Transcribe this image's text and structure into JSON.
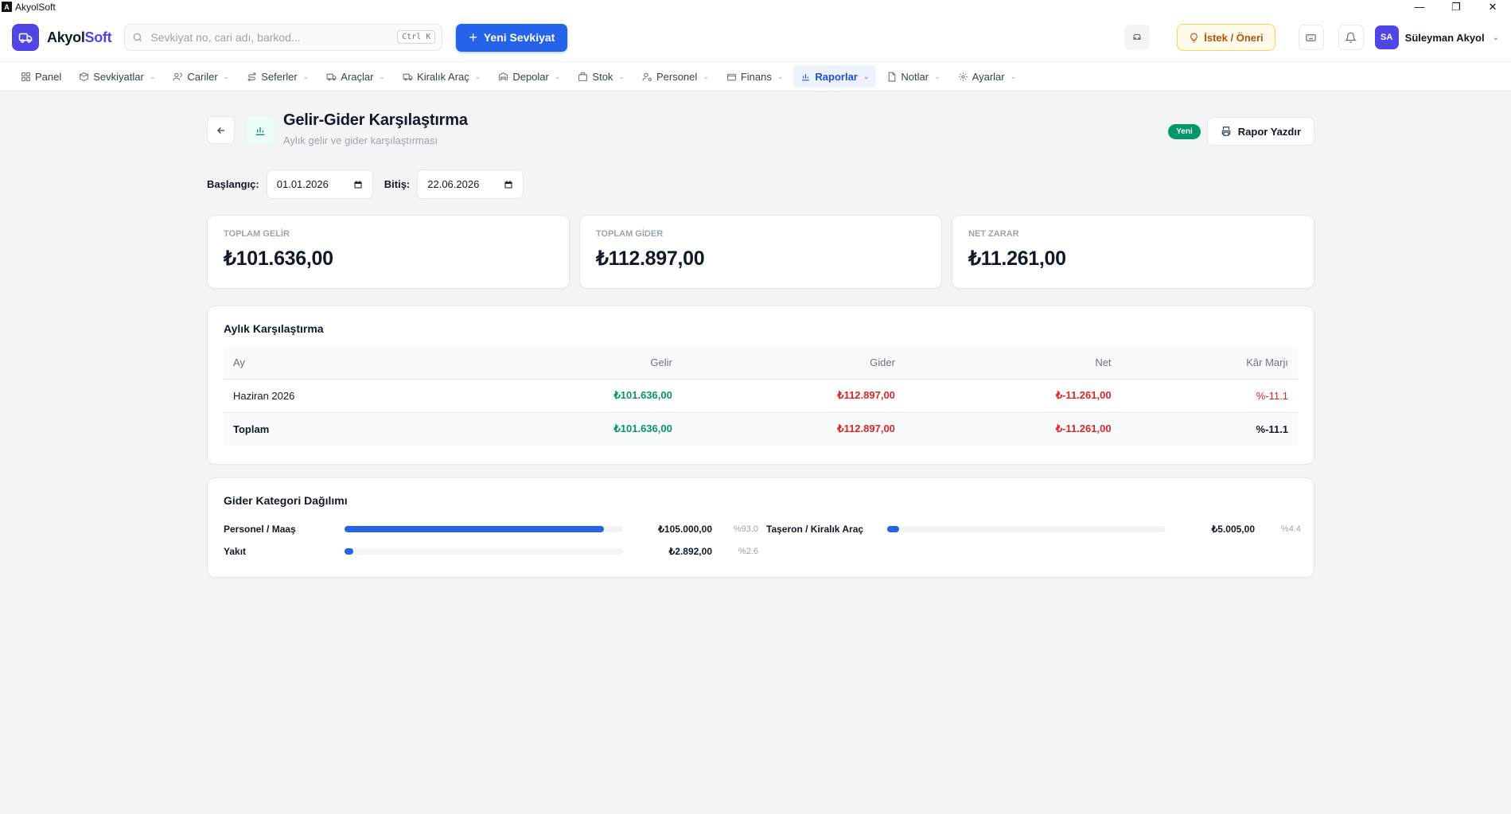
{
  "window": {
    "title": "AkyolSoft"
  },
  "topbar": {
    "brand_a": "Akyol",
    "brand_b": "Soft",
    "search_placeholder": "Sevkiyat no, cari adı, barkod...",
    "search_shortcut": "Ctrl K",
    "new_shipment": "Yeni Sevkiyat",
    "suggest": "İstek / Öneri",
    "user_initials": "SA",
    "user_name": "Süleyman Akyol"
  },
  "nav": [
    {
      "label": "Panel",
      "icon": "grid-icon",
      "dropdown": false,
      "active": false
    },
    {
      "label": "Sevkiyatlar",
      "icon": "box-icon",
      "dropdown": true,
      "active": false
    },
    {
      "label": "Cariler",
      "icon": "users-icon",
      "dropdown": true,
      "active": false
    },
    {
      "label": "Seferler",
      "icon": "route-icon",
      "dropdown": true,
      "active": false
    },
    {
      "label": "Araçlar",
      "icon": "truck-icon",
      "dropdown": true,
      "active": false
    },
    {
      "label": "Kiralık Araç",
      "icon": "truck-icon",
      "dropdown": true,
      "active": false
    },
    {
      "label": "Depolar",
      "icon": "warehouse-icon",
      "dropdown": true,
      "active": false
    },
    {
      "label": "Stok",
      "icon": "stock-icon",
      "dropdown": true,
      "active": false
    },
    {
      "label": "Personel",
      "icon": "user-cog-icon",
      "dropdown": true,
      "active": false
    },
    {
      "label": "Finans",
      "icon": "wallet-icon",
      "dropdown": true,
      "active": false
    },
    {
      "label": "Raporlar",
      "icon": "bar-chart-icon",
      "dropdown": true,
      "active": true
    },
    {
      "label": "Notlar",
      "icon": "file-icon",
      "dropdown": true,
      "active": false
    },
    {
      "label": "Ayarlar",
      "icon": "gear-icon",
      "dropdown": true,
      "active": false
    }
  ],
  "page": {
    "title": "Gelir-Gider Karşılaştırma",
    "subtitle": "Aylık gelir ve gider karşılaştırması",
    "badge": "Yeni",
    "print": "Rapor Yazdır"
  },
  "filters": {
    "start_label": "Başlangıç:",
    "start_value": "01.01.2026",
    "end_label": "Bitiş:",
    "end_value": "22.06.2026"
  },
  "stats": [
    {
      "label": "TOPLAM GELİR",
      "value": "₺101.636,00"
    },
    {
      "label": "TOPLAM GİDER",
      "value": "₺112.897,00"
    },
    {
      "label": "NET ZARAR",
      "value": "₺11.261,00"
    }
  ],
  "monthly": {
    "title": "Aylık Karşılaştırma",
    "columns": [
      "Ay",
      "Gelir",
      "Gider",
      "Net",
      "Kâr Marjı"
    ],
    "rows": [
      {
        "ay": "Haziran 2026",
        "gelir": "₺101.636,00",
        "gider": "₺112.897,00",
        "net": "₺-11.261,00",
        "marj": "%-11.1"
      }
    ],
    "total": {
      "ay": "Toplam",
      "gelir": "₺101.636,00",
      "gider": "₺112.897,00",
      "net": "₺-11.261,00",
      "marj": "%-11.1"
    }
  },
  "distribution": {
    "title": "Gider Kategori Dağılımı",
    "items": [
      {
        "name": "Personel / Maaş",
        "amount": "₺105.000,00",
        "pct": "%93.0",
        "fraction": 0.93
      },
      {
        "name": "Taşeron / Kiralık Araç",
        "amount": "₺5.005,00",
        "pct": "%4.4",
        "fraction": 0.044
      },
      {
        "name": "Yakıt",
        "amount": "₺2.892,00",
        "pct": "%2.6",
        "fraction": 0.026
      }
    ]
  }
}
